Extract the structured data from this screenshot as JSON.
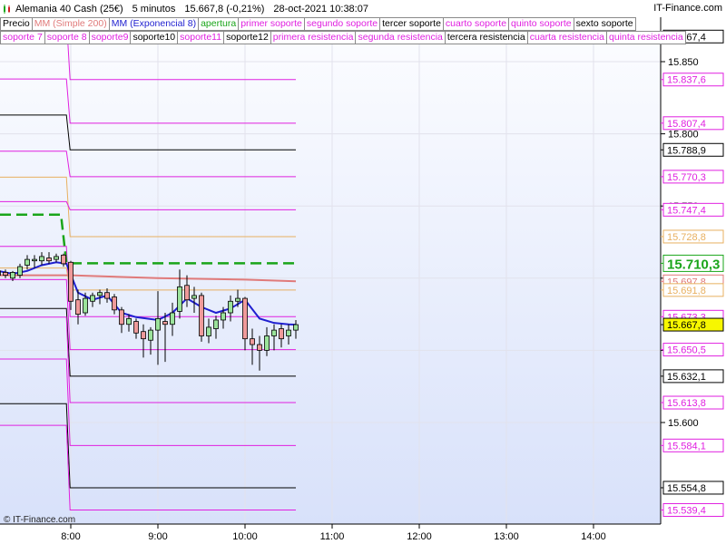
{
  "header": {
    "instrument": "Alemania 40 Cash (25€)",
    "timeframe": "5 minutos",
    "last_change": "15.667,8 (-0,21%)",
    "datetime": "28-oct-2021 10:38:07",
    "site": "IT-Finance.com"
  },
  "legend": {
    "row1": [
      {
        "label": "Precio",
        "color": "#000000"
      },
      {
        "label": "MM (Simple 200)",
        "color": "#e07a7a"
      },
      {
        "label": "MM (Exponencial 8)",
        "color": "#1f1fd0"
      },
      {
        "label": "apertura",
        "color": "#1aa51a"
      },
      {
        "label": "primer soporte",
        "color": "#e020e0"
      },
      {
        "label": "segundo soporte",
        "color": "#e020e0"
      },
      {
        "label": "tercer soporte",
        "color": "#000000"
      },
      {
        "label": "cuarto soporte",
        "color": "#e020e0"
      },
      {
        "label": "quinto soporte",
        "color": "#e020e0"
      },
      {
        "label": "sexto soporte",
        "color": "#000000"
      }
    ],
    "row2": [
      {
        "label": "soporte 7",
        "color": "#e020e0"
      },
      {
        "label": "soporte 8",
        "color": "#e020e0"
      },
      {
        "label": "soporte9",
        "color": "#e020e0"
      },
      {
        "label": "soporte10",
        "color": "#000000"
      },
      {
        "label": "soporte11",
        "color": "#e020e0"
      },
      {
        "label": "soporte12",
        "color": "#000000"
      },
      {
        "label": "primera resistencia",
        "color": "#e020e0"
      },
      {
        "label": "segunda resistencia",
        "color": "#e020e0"
      },
      {
        "label": "tercera resistencia",
        "color": "#000000"
      },
      {
        "label": "cuarta resistencia",
        "color": "#e020e0"
      },
      {
        "label": "quinta resistencia",
        "color": "#e020e0"
      }
    ]
  },
  "credit": "© IT-Finance.com",
  "chart_data": {
    "type": "candlestick",
    "xlabel": "",
    "ylabel": "",
    "ylim": [
      15527,
      15874
    ],
    "x_ticks": [
      "8:00",
      "9:00",
      "10:00",
      "11:00",
      "12:00",
      "13:00",
      "14:00"
    ],
    "x_tick_minutes": [
      480,
      540,
      600,
      660,
      720,
      780,
      840
    ],
    "y_ticks": [
      "15.850",
      "15.800",
      "15.750",
      "15.700",
      "15.650",
      "15.600"
    ],
    "y_tick_values": [
      15850,
      15800,
      15750,
      15700,
      15650,
      15600
    ],
    "grid": true,
    "level_labels": [
      {
        "value": 15867.4,
        "text": "15.867,4",
        "color": "#000000"
      },
      {
        "value": 15837.6,
        "text": "15.837,6",
        "color": "#e020e0"
      },
      {
        "value": 15807.4,
        "text": "15.807,4",
        "color": "#e020e0"
      },
      {
        "value": 15788.9,
        "text": "15.788,9",
        "color": "#000000"
      },
      {
        "value": 15770.3,
        "text": "15.770,3",
        "color": "#e020e0"
      },
      {
        "value": 15747.4,
        "text": "15.747,4",
        "color": "#e020e0"
      },
      {
        "value": 15728.8,
        "text": "15.728,8",
        "color": "#e8b060"
      },
      {
        "value": 15710.3,
        "text": "15.710,3",
        "color": "#1aa51a",
        "big": true
      },
      {
        "value": 15697.8,
        "text": "15.697,8",
        "color": "#e07a7a"
      },
      {
        "value": 15691.8,
        "text": "15.691,8",
        "color": "#e8b060"
      },
      {
        "value": 15673.3,
        "text": "15.673,3",
        "color": "#e020e0"
      },
      {
        "value": 15667.8,
        "text": "15.667,8",
        "color": "#000000",
        "filled": true
      },
      {
        "value": 15650.5,
        "text": "15.650,5",
        "color": "#e020e0"
      },
      {
        "value": 15632.1,
        "text": "15.632,1",
        "color": "#000000"
      },
      {
        "value": 15613.8,
        "text": "15.613,8",
        "color": "#e020e0"
      },
      {
        "value": 15584.1,
        "text": "15.584,1",
        "color": "#e020e0"
      },
      {
        "value": 15554.8,
        "text": "15.554,8",
        "color": "#000000"
      },
      {
        "value": 15539.4,
        "text": "15.539,4",
        "color": "#e020e0"
      }
    ],
    "level_series": [
      {
        "color": "#e020e0",
        "before": 15880,
        "after": 15837.6
      },
      {
        "color": "#e020e0",
        "before": 15838,
        "after": 15807.4
      },
      {
        "color": "#000000",
        "before": 15813,
        "after": 15788.9
      },
      {
        "color": "#e020e0",
        "before": 15788,
        "after": 15770.3
      },
      {
        "color": "#e8b060",
        "before": 15770,
        "after": 15728.8
      },
      {
        "color": "#e020e0",
        "before": 15753,
        "after": 15747.4
      },
      {
        "color": "#e020e0",
        "before": 15722,
        "after": 15673.3
      },
      {
        "color": "#e8b060",
        "before": 15707,
        "after": 15691.8
      },
      {
        "color": "#e020e0",
        "before": 15699,
        "after": 15650.5
      },
      {
        "color": "#000000",
        "before": 15679,
        "after": 15632.1
      },
      {
        "color": "#e020e0",
        "before": 15673,
        "after": 15613.8
      },
      {
        "color": "#e020e0",
        "before": 15644,
        "after": 15584.1
      },
      {
        "color": "#000000",
        "before": 15613,
        "after": 15554.8
      },
      {
        "color": "#e020e0",
        "before": 15598,
        "after": 15539.4
      }
    ],
    "level_start_minute": 430,
    "level_switch_minute": 477,
    "level_end_minute": 635,
    "apertura": {
      "before": 15744,
      "after": 15710.3,
      "color": "#1aa51a"
    },
    "sma200": {
      "color": "#e07a7a",
      "minutes": [
        430,
        480,
        540,
        600,
        635
      ],
      "values": [
        15702,
        15702,
        15700,
        15699,
        15697.8
      ]
    },
    "ema8": {
      "color": "#1f1fd0",
      "minutes": [
        430,
        440,
        450,
        460,
        470,
        477,
        485,
        495,
        505,
        515,
        525,
        540,
        550,
        560,
        570,
        580,
        590,
        600,
        610,
        620,
        630,
        635
      ],
      "values": [
        15705,
        15703,
        15705,
        15709,
        15711,
        15710,
        15690,
        15685,
        15688,
        15676,
        15673,
        15671,
        15676,
        15686,
        15680,
        15676,
        15679,
        15685,
        15672,
        15669,
        15668,
        15667.8
      ]
    },
    "candles": [
      {
        "t": 430,
        "o": 15702,
        "h": 15708,
        "l": 15700,
        "c": 15705
      },
      {
        "t": 435,
        "o": 15704,
        "h": 15706,
        "l": 15700,
        "c": 15702
      },
      {
        "t": 440,
        "o": 15700,
        "h": 15705,
        "l": 15698,
        "c": 15704
      },
      {
        "t": 445,
        "o": 15702,
        "h": 15710,
        "l": 15700,
        "c": 15708
      },
      {
        "t": 450,
        "o": 15709,
        "h": 15716,
        "l": 15706,
        "c": 15713
      },
      {
        "t": 455,
        "o": 15712,
        "h": 15716,
        "l": 15707,
        "c": 15713
      },
      {
        "t": 460,
        "o": 15712,
        "h": 15718,
        "l": 15709,
        "c": 15715
      },
      {
        "t": 465,
        "o": 15714,
        "h": 15718,
        "l": 15710,
        "c": 15712
      },
      {
        "t": 470,
        "o": 15713,
        "h": 15717,
        "l": 15711,
        "c": 15715
      },
      {
        "t": 475,
        "o": 15716,
        "h": 15717,
        "l": 15708,
        "c": 15710
      },
      {
        "t": 480,
        "o": 15711,
        "h": 15712,
        "l": 15678,
        "c": 15684
      },
      {
        "t": 485,
        "o": 15685,
        "h": 15692,
        "l": 15668,
        "c": 15675
      },
      {
        "t": 490,
        "o": 15676,
        "h": 15690,
        "l": 15674,
        "c": 15686
      },
      {
        "t": 495,
        "o": 15684,
        "h": 15690,
        "l": 15680,
        "c": 15688
      },
      {
        "t": 500,
        "o": 15688,
        "h": 15692,
        "l": 15682,
        "c": 15690
      },
      {
        "t": 505,
        "o": 15690,
        "h": 15693,
        "l": 15683,
        "c": 15686
      },
      {
        "t": 510,
        "o": 15687,
        "h": 15689,
        "l": 15675,
        "c": 15678
      },
      {
        "t": 515,
        "o": 15678,
        "h": 15680,
        "l": 15662,
        "c": 15668
      },
      {
        "t": 520,
        "o": 15668,
        "h": 15675,
        "l": 15663,
        "c": 15672
      },
      {
        "t": 525,
        "o": 15670,
        "h": 15672,
        "l": 15658,
        "c": 15662
      },
      {
        "t": 530,
        "o": 15663,
        "h": 15668,
        "l": 15645,
        "c": 15658
      },
      {
        "t": 535,
        "o": 15657,
        "h": 15666,
        "l": 15647,
        "c": 15664
      },
      {
        "t": 540,
        "o": 15664,
        "h": 15691,
        "l": 15640,
        "c": 15672
      },
      {
        "t": 545,
        "o": 15670,
        "h": 15676,
        "l": 15642,
        "c": 15668
      },
      {
        "t": 550,
        "o": 15668,
        "h": 15683,
        "l": 15660,
        "c": 15676
      },
      {
        "t": 555,
        "o": 15677,
        "h": 15706,
        "l": 15672,
        "c": 15694
      },
      {
        "t": 560,
        "o": 15695,
        "h": 15702,
        "l": 15680,
        "c": 15685
      },
      {
        "t": 565,
        "o": 15686,
        "h": 15694,
        "l": 15676,
        "c": 15688
      },
      {
        "t": 570,
        "o": 15688,
        "h": 15690,
        "l": 15656,
        "c": 15660
      },
      {
        "t": 575,
        "o": 15660,
        "h": 15672,
        "l": 15655,
        "c": 15666
      },
      {
        "t": 580,
        "o": 15665,
        "h": 15674,
        "l": 15658,
        "c": 15671
      },
      {
        "t": 585,
        "o": 15671,
        "h": 15680,
        "l": 15665,
        "c": 15676
      },
      {
        "t": 590,
        "o": 15676,
        "h": 15688,
        "l": 15670,
        "c": 15684
      },
      {
        "t": 595,
        "o": 15684,
        "h": 15692,
        "l": 15680,
        "c": 15686
      },
      {
        "t": 600,
        "o": 15686,
        "h": 15687,
        "l": 15650,
        "c": 15658
      },
      {
        "t": 605,
        "o": 15658,
        "h": 15665,
        "l": 15640,
        "c": 15654
      },
      {
        "t": 610,
        "o": 15654,
        "h": 15660,
        "l": 15636,
        "c": 15650
      },
      {
        "t": 615,
        "o": 15650,
        "h": 15666,
        "l": 15646,
        "c": 15660
      },
      {
        "t": 620,
        "o": 15660,
        "h": 15668,
        "l": 15650,
        "c": 15664
      },
      {
        "t": 625,
        "o": 15665,
        "h": 15668,
        "l": 15652,
        "c": 15658
      },
      {
        "t": 630,
        "o": 15660,
        "h": 15668,
        "l": 15654,
        "c": 15664
      },
      {
        "t": 635,
        "o": 15664,
        "h": 15671,
        "l": 15658,
        "c": 15667.8
      }
    ]
  }
}
